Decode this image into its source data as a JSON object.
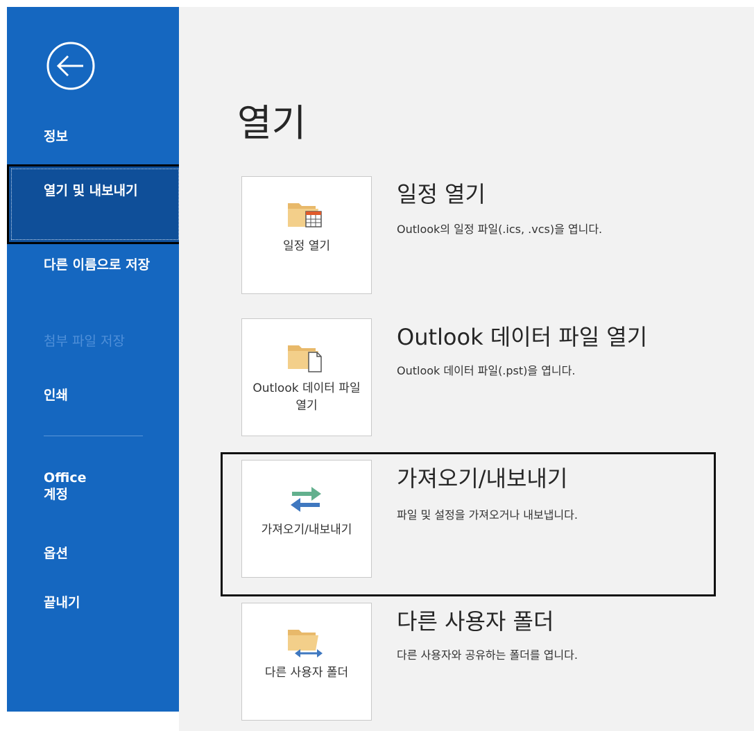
{
  "sidebar": {
    "back_label": "Back",
    "items": [
      {
        "label": "정보",
        "state": "normal"
      },
      {
        "label": "열기 및 내보내기",
        "state": "selected"
      },
      {
        "label": "다른 이름으로 저장",
        "state": "normal"
      },
      {
        "label": "첨부 파일 저장",
        "state": "disabled"
      },
      {
        "label": "인쇄",
        "state": "normal"
      },
      {
        "label": "Office 계정",
        "state": "normal"
      },
      {
        "label": "옵션",
        "state": "normal"
      },
      {
        "label": "끝내기",
        "state": "normal"
      }
    ],
    "background_color": "#1567c0",
    "selected_color": "#0f4f99"
  },
  "main": {
    "title": "열기",
    "options": [
      {
        "card_label": "일정 열기",
        "icon": "folder-calendar-icon",
        "title": "일정 열기",
        "description": "Outlook의 일정 파일(.ics, .vcs)을 엽니다."
      },
      {
        "card_label": "Outlook 데이터 파일 열기",
        "icon": "folder-document-icon",
        "title": "Outlook 데이터 파일 열기",
        "description": "Outlook 데이터 파일(.pst)을 엽니다."
      },
      {
        "card_label": "가져오기/내보내기",
        "icon": "import-export-arrows-icon",
        "title": "가져오기/내보내기",
        "description": "파일 및 설정을 가져오거나 내보냅니다."
      },
      {
        "card_label": "다른 사용자 폴더",
        "icon": "shared-folder-icon",
        "title": "다른 사용자 폴더",
        "description": "다른 사용자와 공유하는 폴더를 엽니다."
      }
    ],
    "background_color": "#f2f2f2"
  }
}
